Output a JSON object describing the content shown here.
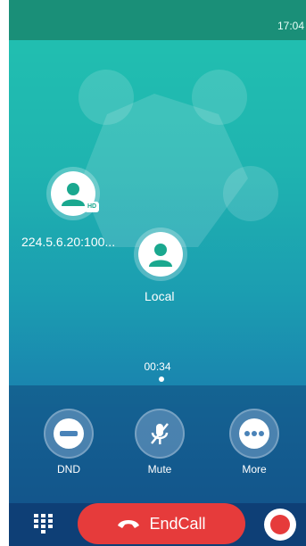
{
  "status_bar": {
    "time": "17:04"
  },
  "participants": [
    {
      "label": "224.5.6.20:100...",
      "badge": "HD"
    },
    {
      "label": "Local"
    }
  ],
  "call": {
    "duration": "00:34"
  },
  "controls": [
    {
      "label": "DND",
      "icon": "minus-icon"
    },
    {
      "label": "Mute",
      "icon": "mic-off-icon"
    },
    {
      "label": "More",
      "icon": "more-dots-icon"
    }
  ],
  "bottom_bar": {
    "keypad_icon": "dialpad-icon",
    "end_call_label": "EndCall",
    "record_icon": "record-icon"
  },
  "colors": {
    "status_bar": "#1a8f78",
    "end_call": "#e63b3b",
    "bottom_bar": "#0e3f76",
    "accent": "#1aa88f"
  }
}
